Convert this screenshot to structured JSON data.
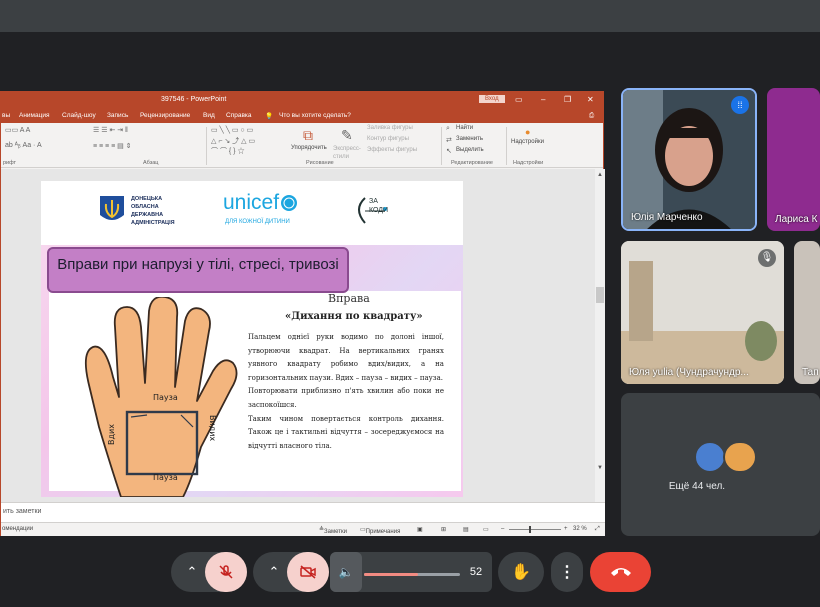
{
  "ppt": {
    "file_name": "397546  -  PowerPoint",
    "login_label": "Вход",
    "menu": [
      "вы",
      "Анимация",
      "Слайд-шоу",
      "Запись",
      "Рецензирование",
      "Вид",
      "Справка",
      "Что вы хотите сделать?"
    ],
    "ribbon": {
      "arrange": "Упорядочить",
      "express": "Экспресс-стили",
      "fill": "Заливка фигуры",
      "outline": "Контур фигуры",
      "effects": "Эффекты фигуры",
      "find": "Найти",
      "replace": "Заменить",
      "select": "Выделить",
      "addins": "Надстройки",
      "group_font": "рифт",
      "group_para": "Абзац",
      "group_draw": "Рисование",
      "group_edit": "Редактирование",
      "group_addins": "Надстройки"
    },
    "slide": {
      "admin_logo": "ДОНЕЦЬКА ОБЛАСНА ДЕРЖАВНА АДМІНІСТРАЦІЯ",
      "unicef": "unicef",
      "unicef_sub": "ДЛЯ КОЖНОЇ ДИТИНИ",
      "za_kody": "ЗА КОДИ",
      "title": "Вправи при напрузі у тілі, стресі, тривозі",
      "exercise": "Вправа",
      "exercise_name": "«Дихання по квадрату»",
      "hand_top": "Пауза",
      "hand_bottom": "Пауза",
      "hand_left": "Вдих",
      "hand_right": "Видих",
      "p1": "Пальцем однієї руки водимо по долоні іншої, утворюючи квадрат. На вертикальних гранях уявного квадрату робимо вдих/видих, а на горизонтальних паузи. Вдих – пауза – видих – пауза.",
      "p2": "Повторювати приблизно п'ять хвилин або поки не заспокоїшся.",
      "p3": "Таким чином повертається контроль дихання. Також це і тактильні відчуття – зосереджуємося на відчутті власного тіла."
    },
    "notes_label": "ить заметки",
    "status": {
      "left": "омендации",
      "notes": "Заметки",
      "comments": "Примечания",
      "zoom": "32 %"
    }
  },
  "participants": [
    {
      "name": "Юлія Марченко"
    },
    {
      "name": "Лариса К"
    },
    {
      "name": "Юля yulia (Чундрачундр..."
    },
    {
      "name": "Тап"
    }
  ],
  "more_label": "Ещё 44 чел.",
  "volume": {
    "value": "52",
    "level": 0.56
  },
  "colors": {
    "end_call": "#ea4335",
    "ppt_accent": "#b7472a",
    "muted": "#f6d1cd"
  }
}
